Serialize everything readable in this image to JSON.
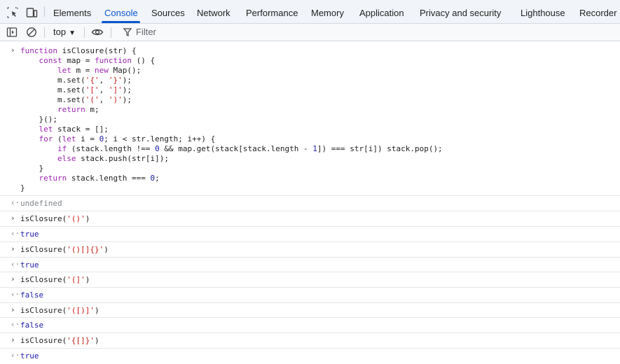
{
  "tabs": [
    "Elements",
    "Console",
    "Sources",
    "Network",
    "Performance",
    "Memory",
    "Application",
    "Privacy and security",
    "Lighthouse",
    "Recorder"
  ],
  "active_tab": "Console",
  "toolbar": {
    "context": "top",
    "filter_placeholder": "Filter"
  },
  "icons": {
    "inspect": "inspect-element-icon",
    "device": "device-toolbar-icon",
    "sidebar": "show-sidebar-icon",
    "clear": "clear-console-icon",
    "eye": "live-expression-icon",
    "filter": "filter-icon"
  },
  "colors": {
    "accent": "#0b57d0",
    "keyword": "#9c27b0",
    "string": "#c41a16",
    "number": "#1a1aa6"
  },
  "console": {
    "function_code": [
      "function isClosure(str) {",
      "    const map = function () {",
      "        let m = new Map();",
      "        m.set('{', '}');",
      "        m.set('[', ']');",
      "        m.set('(', ')');",
      "        return m;",
      "    }();",
      "    let stack = [];",
      "    for (let i = 0; i < str.length; i++) {",
      "        if (stack.length !== 0 && map.get(stack[stack.length - 1]) === str[i]) stack.pop();",
      "        else stack.push(str[i]);",
      "    }",
      "    return stack.length === 0;",
      "}"
    ],
    "function_result": "undefined",
    "calls": [
      {
        "input": "isClosure('()')",
        "result": "true"
      },
      {
        "input": "isClosure('()[]{}')",
        "result": "true"
      },
      {
        "input": "isClosure('(]')",
        "result": "false"
      },
      {
        "input": "isClosure('([)]')",
        "result": "false"
      },
      {
        "input": "isClosure('{[]}')",
        "result": "true"
      }
    ]
  }
}
